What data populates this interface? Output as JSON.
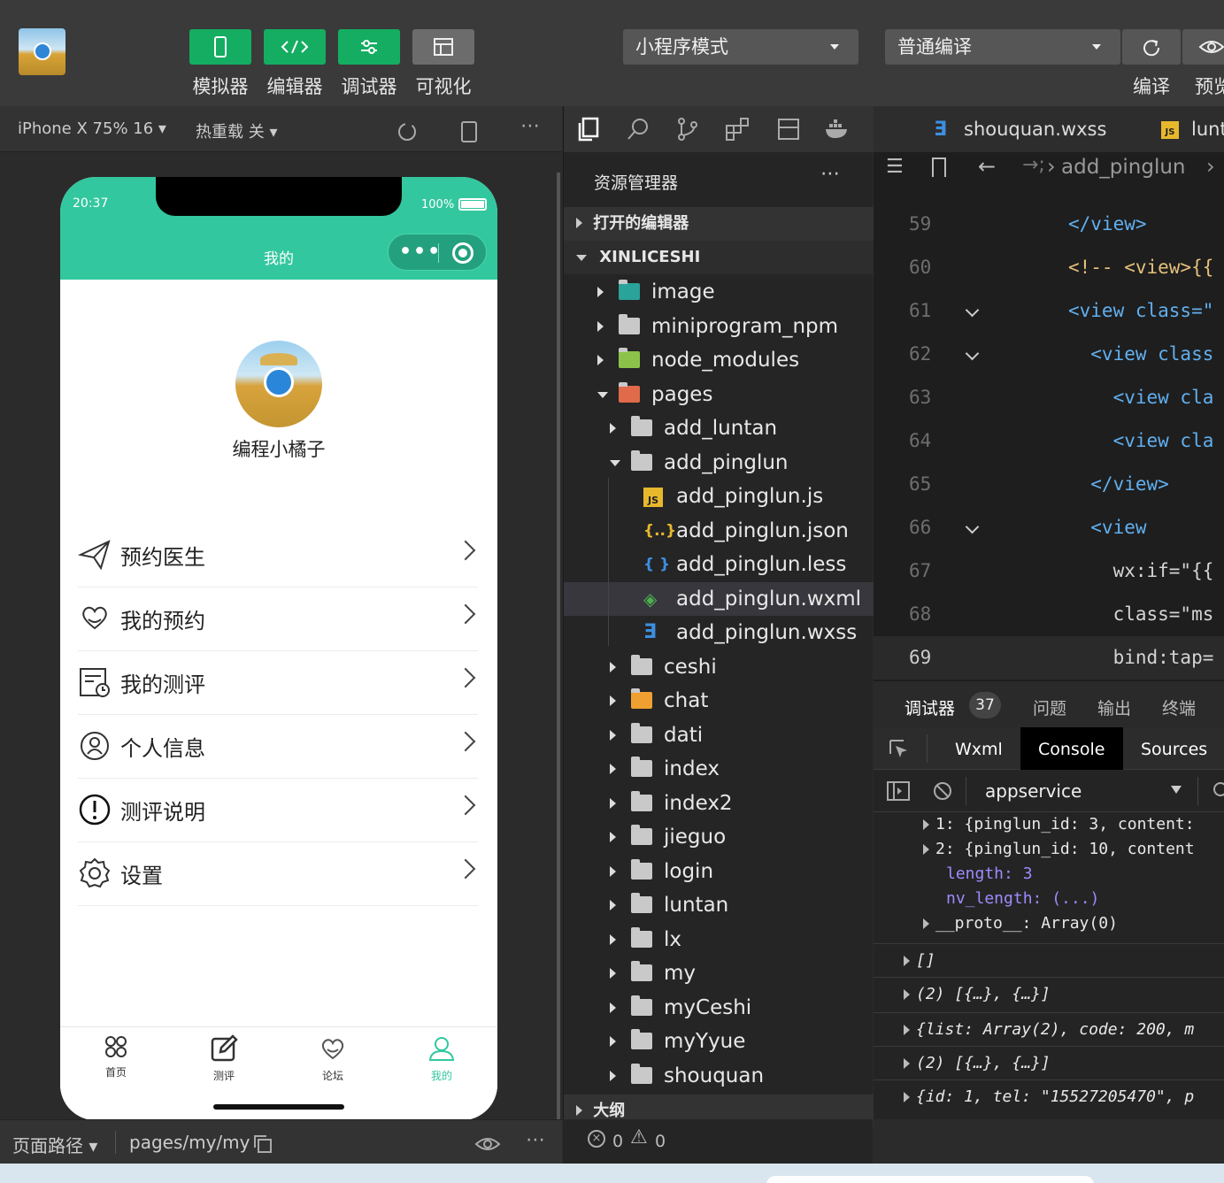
{
  "toolbar": {
    "buttons": [
      {
        "label": "模拟器",
        "icon": "phone-icon"
      },
      {
        "label": "编辑器",
        "icon": "code-icon"
      },
      {
        "label": "调试器",
        "icon": "sliders-icon"
      },
      {
        "label": "可视化",
        "icon": "layout-icon"
      }
    ],
    "mode_select": "小程序模式",
    "compile_select": "普通编译",
    "compile_label": "编译",
    "preview_label": "预览"
  },
  "simulator": {
    "device": "iPhone X 75% 16",
    "hot_reload": "热重载 关",
    "phone": {
      "time": "20:37",
      "battery": "100%",
      "title": "我的",
      "username": "编程小橘子",
      "menu": [
        {
          "label": "预约医生",
          "icon": "send-icon"
        },
        {
          "label": "我的预约",
          "icon": "heart-hand-icon"
        },
        {
          "label": "我的测评",
          "icon": "calendar-clock-icon"
        },
        {
          "label": "个人信息",
          "icon": "user-circle-icon"
        },
        {
          "label": "测评说明",
          "icon": "info-circle-icon"
        },
        {
          "label": "设置",
          "icon": "gear-icon"
        }
      ],
      "tabs": [
        {
          "label": "首页",
          "icon": "grid-icon"
        },
        {
          "label": "测评",
          "icon": "edit-icon"
        },
        {
          "label": "论坛",
          "icon": "heart-hand-icon"
        },
        {
          "label": "我的",
          "icon": "user-icon"
        }
      ],
      "accent": "#33c79f"
    },
    "footer": {
      "path_label": "页面路径",
      "path_value": "pages/my/my"
    }
  },
  "explorer": {
    "title": "资源管理器",
    "open_editors": "打开的编辑器",
    "project": "XINLICESHI",
    "outline": "大纲",
    "tree": [
      {
        "name": "image",
        "type": "folder-special"
      },
      {
        "name": "miniprogram_npm",
        "type": "folder"
      },
      {
        "name": "node_modules",
        "type": "folder-node"
      },
      {
        "name": "pages",
        "type": "folder-open-red"
      },
      {
        "name": "add_luntan",
        "type": "folder"
      },
      {
        "name": "add_pinglun",
        "type": "folder-open"
      },
      {
        "name": "add_pinglun.js",
        "type": "file-js"
      },
      {
        "name": "add_pinglun.json",
        "type": "file-json"
      },
      {
        "name": "add_pinglun.less",
        "type": "file-less"
      },
      {
        "name": "add_pinglun.wxml",
        "type": "file-wxml"
      },
      {
        "name": "add_pinglun.wxss",
        "type": "file-wxss"
      },
      {
        "name": "ceshi",
        "type": "folder"
      },
      {
        "name": "chat",
        "type": "folder-chat"
      },
      {
        "name": "dati",
        "type": "folder"
      },
      {
        "name": "index",
        "type": "folder"
      },
      {
        "name": "index2",
        "type": "folder"
      },
      {
        "name": "jieguo",
        "type": "folder"
      },
      {
        "name": "login",
        "type": "folder"
      },
      {
        "name": "luntan",
        "type": "folder"
      },
      {
        "name": "lx",
        "type": "folder"
      },
      {
        "name": "my",
        "type": "folder"
      },
      {
        "name": "myCeshi",
        "type": "folder"
      },
      {
        "name": "myYyue",
        "type": "folder"
      },
      {
        "name": "shouquan",
        "type": "folder"
      }
    ],
    "errors": "0",
    "warnings": "0"
  },
  "editor": {
    "tabs": [
      "shouquan.wxss",
      "lunt"
    ],
    "breadcrumb": "add_pinglun",
    "lines": [
      {
        "n": "59",
        "text": "</view>"
      },
      {
        "n": "60",
        "text": "<!-- <view>{{"
      },
      {
        "n": "61",
        "text": "<view class=\""
      },
      {
        "n": "62",
        "text": "  <view class"
      },
      {
        "n": "63",
        "text": "    <view cla"
      },
      {
        "n": "64",
        "text": "    <view cla"
      },
      {
        "n": "65",
        "text": "  </view>"
      },
      {
        "n": "66",
        "text": "  <view"
      },
      {
        "n": "67",
        "text": "    wx:if=\"{{"
      },
      {
        "n": "68",
        "text": "    class=\"ms"
      },
      {
        "n": "69",
        "text": "    bind:tap="
      }
    ]
  },
  "devtools": {
    "tabs": [
      "调试器",
      "问题",
      "输出",
      "终端"
    ],
    "badge": "37",
    "subtabs": [
      "Wxml",
      "Console",
      "Sources"
    ],
    "context": "appservice",
    "console": [
      "1: {pinglun_id: 3, content:",
      "2: {pinglun_id: 10, content",
      "length: 3",
      "nv_length: (...)",
      "__proto__: Array(0)",
      "[]",
      "(2) [{…}, {…}]",
      "{list: Array(2), code: 200, m",
      "(2) [{…}, {…}]",
      "{id: 1, tel: \"15527205470\", p"
    ]
  }
}
